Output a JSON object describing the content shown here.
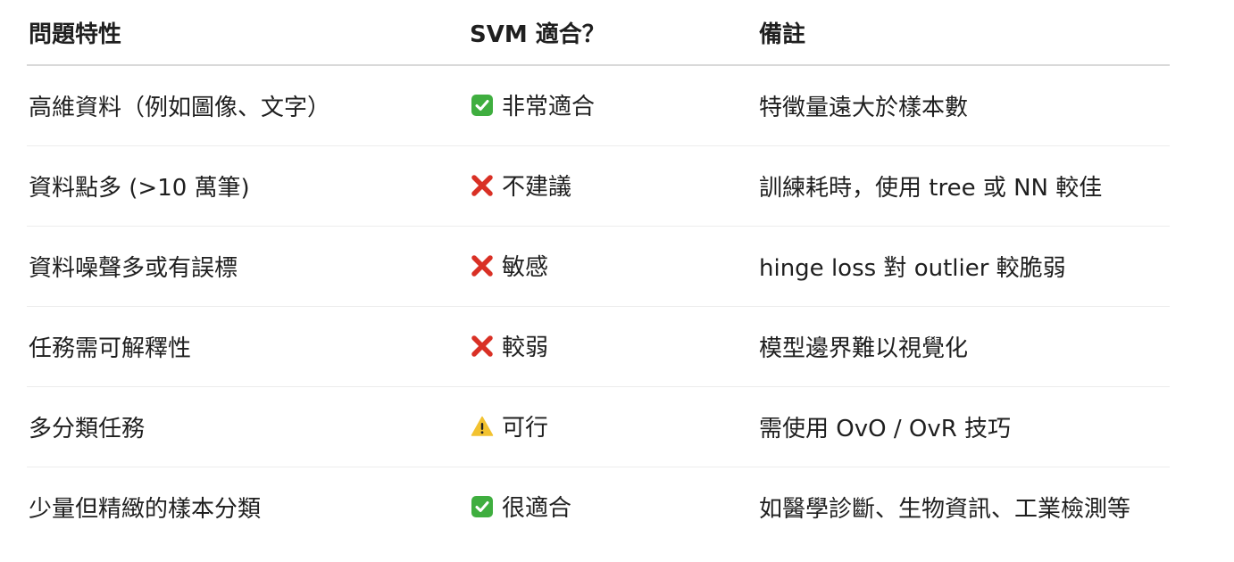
{
  "table": {
    "headers": [
      "問題特性",
      "SVM 適合？",
      "備註"
    ],
    "rows": [
      {
        "feature": "高維資料（例如圖像、文字）",
        "verdict_icon": "check-icon",
        "verdict": "非常適合",
        "note": "特徵量遠大於樣本數"
      },
      {
        "feature": "資料點多 (>10 萬筆)",
        "verdict_icon": "cross-icon",
        "verdict": "不建議",
        "note": "訓練耗時，使用 tree 或 NN 較佳"
      },
      {
        "feature": "資料噪聲多或有誤標",
        "verdict_icon": "cross-icon",
        "verdict": "敏感",
        "note": "hinge loss 對 outlier 較脆弱"
      },
      {
        "feature": "任務需可解釋性",
        "verdict_icon": "cross-icon",
        "verdict": "較弱",
        "note": "模型邊界難以視覺化"
      },
      {
        "feature": "多分類任務",
        "verdict_icon": "warning-icon",
        "verdict": "可行",
        "note": "需使用 OvO / OvR 技巧"
      },
      {
        "feature": "少量但精緻的樣本分類",
        "verdict_icon": "check-icon",
        "verdict": "很適合",
        "note": "如醫學診斷、生物資訊、工業檢測等"
      }
    ]
  },
  "colors": {
    "check": "#3fae3f",
    "cross": "#d93025",
    "warning": "#f2c230"
  }
}
